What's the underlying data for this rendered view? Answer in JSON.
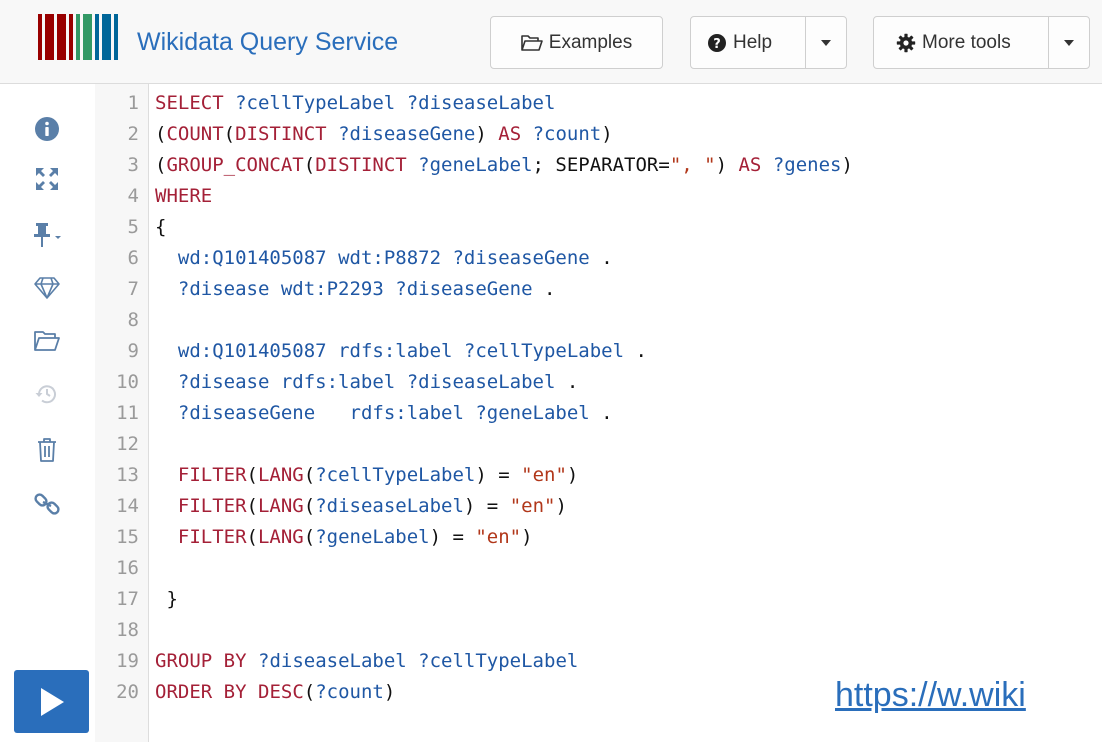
{
  "header": {
    "title": "Wikidata Query Service",
    "examples_label": "Examples",
    "help_label": "Help",
    "more_tools_label": "More tools"
  },
  "colors": {
    "accent": "#2a6ebb",
    "keyword": "#a42037",
    "variable": "#1f57a4",
    "string": "#b1371a"
  },
  "toolbar": {
    "icons": [
      "info-icon",
      "fullscreen-icon",
      "pin-icon",
      "diamond-icon",
      "folder-open-icon",
      "history-icon",
      "trash-icon",
      "link-icon",
      "play-icon"
    ]
  },
  "editor": {
    "lines": [
      {
        "num": "1",
        "tokens": [
          {
            "t": "kw",
            "v": "SELECT"
          },
          {
            "t": "pn",
            "v": " "
          },
          {
            "t": "var",
            "v": "?cellTypeLabel"
          },
          {
            "t": "pn",
            "v": " "
          },
          {
            "t": "var",
            "v": "?diseaseLabel"
          }
        ]
      },
      {
        "num": "2",
        "tokens": [
          {
            "t": "pn",
            "v": "("
          },
          {
            "t": "kw",
            "v": "COUNT"
          },
          {
            "t": "pn",
            "v": "("
          },
          {
            "t": "kw",
            "v": "DISTINCT"
          },
          {
            "t": "pn",
            "v": " "
          },
          {
            "t": "var",
            "v": "?diseaseGene"
          },
          {
            "t": "pn",
            "v": ") "
          },
          {
            "t": "kw",
            "v": "AS"
          },
          {
            "t": "pn",
            "v": " "
          },
          {
            "t": "var",
            "v": "?count"
          },
          {
            "t": "pn",
            "v": ")"
          }
        ]
      },
      {
        "num": "3",
        "tokens": [
          {
            "t": "pn",
            "v": "("
          },
          {
            "t": "kw",
            "v": "GROUP_CONCAT"
          },
          {
            "t": "pn",
            "v": "("
          },
          {
            "t": "kw",
            "v": "DISTINCT"
          },
          {
            "t": "pn",
            "v": " "
          },
          {
            "t": "var",
            "v": "?geneLabel"
          },
          {
            "t": "pn",
            "v": "; SEPARATOR="
          },
          {
            "t": "str",
            "v": "\", \""
          },
          {
            "t": "pn",
            "v": ") "
          },
          {
            "t": "kw",
            "v": "AS"
          },
          {
            "t": "pn",
            "v": " "
          },
          {
            "t": "var",
            "v": "?genes"
          },
          {
            "t": "pn",
            "v": ")"
          }
        ]
      },
      {
        "num": "4",
        "tokens": [
          {
            "t": "kw",
            "v": "WHERE"
          }
        ]
      },
      {
        "num": "5",
        "tokens": [
          {
            "t": "pn",
            "v": "{"
          }
        ]
      },
      {
        "num": "6",
        "tokens": [
          {
            "t": "pn",
            "v": "  "
          },
          {
            "t": "var",
            "v": "wd:Q101405087"
          },
          {
            "t": "pn",
            "v": " "
          },
          {
            "t": "var",
            "v": "wdt:P8872"
          },
          {
            "t": "pn",
            "v": " "
          },
          {
            "t": "var",
            "v": "?diseaseGene"
          },
          {
            "t": "pn",
            "v": " ."
          }
        ]
      },
      {
        "num": "7",
        "tokens": [
          {
            "t": "pn",
            "v": "  "
          },
          {
            "t": "var",
            "v": "?disease"
          },
          {
            "t": "pn",
            "v": " "
          },
          {
            "t": "var",
            "v": "wdt:P2293"
          },
          {
            "t": "pn",
            "v": " "
          },
          {
            "t": "var",
            "v": "?diseaseGene"
          },
          {
            "t": "pn",
            "v": " ."
          }
        ]
      },
      {
        "num": "8",
        "tokens": []
      },
      {
        "num": "9",
        "tokens": [
          {
            "t": "pn",
            "v": "  "
          },
          {
            "t": "var",
            "v": "wd:Q101405087"
          },
          {
            "t": "pn",
            "v": " "
          },
          {
            "t": "var",
            "v": "rdfs:label"
          },
          {
            "t": "pn",
            "v": " "
          },
          {
            "t": "var",
            "v": "?cellTypeLabel"
          },
          {
            "t": "pn",
            "v": " ."
          }
        ]
      },
      {
        "num": "10",
        "tokens": [
          {
            "t": "pn",
            "v": "  "
          },
          {
            "t": "var",
            "v": "?disease"
          },
          {
            "t": "pn",
            "v": " "
          },
          {
            "t": "var",
            "v": "rdfs:label"
          },
          {
            "t": "pn",
            "v": " "
          },
          {
            "t": "var",
            "v": "?diseaseLabel"
          },
          {
            "t": "pn",
            "v": " ."
          }
        ]
      },
      {
        "num": "11",
        "tokens": [
          {
            "t": "pn",
            "v": "  "
          },
          {
            "t": "var",
            "v": "?diseaseGene"
          },
          {
            "t": "pn",
            "v": "   "
          },
          {
            "t": "var",
            "v": "rdfs:label"
          },
          {
            "t": "pn",
            "v": " "
          },
          {
            "t": "var",
            "v": "?geneLabel"
          },
          {
            "t": "pn",
            "v": " ."
          }
        ]
      },
      {
        "num": "12",
        "tokens": []
      },
      {
        "num": "13",
        "tokens": [
          {
            "t": "pn",
            "v": "  "
          },
          {
            "t": "kw",
            "v": "FILTER"
          },
          {
            "t": "pn",
            "v": "("
          },
          {
            "t": "kw",
            "v": "LANG"
          },
          {
            "t": "pn",
            "v": "("
          },
          {
            "t": "var",
            "v": "?cellTypeLabel"
          },
          {
            "t": "pn",
            "v": ") = "
          },
          {
            "t": "str",
            "v": "\"en\""
          },
          {
            "t": "pn",
            "v": ")"
          }
        ]
      },
      {
        "num": "14",
        "tokens": [
          {
            "t": "pn",
            "v": "  "
          },
          {
            "t": "kw",
            "v": "FILTER"
          },
          {
            "t": "pn",
            "v": "("
          },
          {
            "t": "kw",
            "v": "LANG"
          },
          {
            "t": "pn",
            "v": "("
          },
          {
            "t": "var",
            "v": "?diseaseLabel"
          },
          {
            "t": "pn",
            "v": ") = "
          },
          {
            "t": "str",
            "v": "\"en\""
          },
          {
            "t": "pn",
            "v": ")"
          }
        ]
      },
      {
        "num": "15",
        "tokens": [
          {
            "t": "pn",
            "v": "  "
          },
          {
            "t": "kw",
            "v": "FILTER"
          },
          {
            "t": "pn",
            "v": "("
          },
          {
            "t": "kw",
            "v": "LANG"
          },
          {
            "t": "pn",
            "v": "("
          },
          {
            "t": "var",
            "v": "?geneLabel"
          },
          {
            "t": "pn",
            "v": ") = "
          },
          {
            "t": "str",
            "v": "\"en\""
          },
          {
            "t": "pn",
            "v": ")"
          }
        ]
      },
      {
        "num": "16",
        "tokens": []
      },
      {
        "num": "17",
        "tokens": [
          {
            "t": "pn",
            "v": " }"
          }
        ]
      },
      {
        "num": "18",
        "tokens": []
      },
      {
        "num": "19",
        "tokens": [
          {
            "t": "kw",
            "v": "GROUP"
          },
          {
            "t": "pn",
            "v": " "
          },
          {
            "t": "kw",
            "v": "BY"
          },
          {
            "t": "pn",
            "v": " "
          },
          {
            "t": "var",
            "v": "?diseaseLabel"
          },
          {
            "t": "pn",
            "v": " "
          },
          {
            "t": "var",
            "v": "?cellTypeLabel"
          }
        ]
      },
      {
        "num": "20",
        "tokens": [
          {
            "t": "kw",
            "v": "ORDER"
          },
          {
            "t": "pn",
            "v": " "
          },
          {
            "t": "kw",
            "v": "BY"
          },
          {
            "t": "pn",
            "v": " "
          },
          {
            "t": "kw",
            "v": "DESC"
          },
          {
            "t": "pn",
            "v": "("
          },
          {
            "t": "var",
            "v": "?count"
          },
          {
            "t": "pn",
            "v": ")"
          }
        ]
      }
    ]
  },
  "overlay": {
    "url_text": "https://w.wiki"
  }
}
